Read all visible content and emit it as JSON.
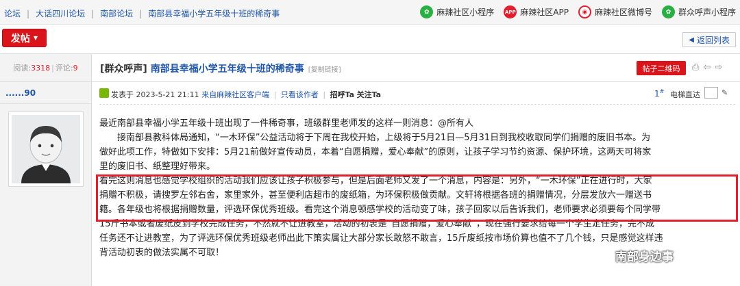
{
  "breadcrumb": [
    "论坛",
    "大话四川论坛",
    "南部论坛",
    "南部县幸福小学五年级十班的稀奇事"
  ],
  "top_links": [
    {
      "label": "麻辣社区小程序",
      "icon": "mini-program-icon"
    },
    {
      "label": "麻辣社区APP",
      "icon": "app-icon",
      "icon_text": "APP"
    },
    {
      "label": "麻辣社区微博号",
      "icon": "weibo-icon"
    },
    {
      "label": "群众呼声小程序",
      "icon": "mini-program-icon"
    }
  ],
  "toolbar": {
    "post_label": "发帖",
    "back_label": "返回列表"
  },
  "thread": {
    "stats_read_label": "阅读:",
    "stats_read": "3318",
    "stats_sep": "|",
    "stats_reply_label": "评论:",
    "stats_reply": "9",
    "category": "[群众呼声]",
    "title": "南部县幸福小学五年级十班的稀奇事",
    "copy_link": "[复制链接]",
    "qr_label": "帖子二维码"
  },
  "user": {
    "name": "......90"
  },
  "post": {
    "posted_prefix": "发表于",
    "posted_time": "2023-5-21 21:11",
    "source": "来自麻辣社区客户端",
    "author_only": "只看该作者",
    "recruit": "招呼Ta",
    "follow": "关注Ta",
    "floor": "1",
    "floor_sup": "#",
    "elevator_label": "电梯直达"
  },
  "content": {
    "lines": [
      "最近南部县幸福小学五年级十班出现了一件稀奇事，班级群里老师发的这样一则消息：@所有人",
      "接南部县教科体局通知，“一木环保”公益活动将于下周在我校开始，上级将于5月21日—5月31日到我校收取同学们捐赠的废旧书本。为",
      "做好此项工作，特做如下安排：5月21前做好宣传动员，本着“自愿捐赠，爱心奉献”的原则，让孩子学习节约资源、保护环境，这两天可将家",
      "里的废旧书、纸整理好带来。",
      "看完这则消息也感觉学校组织的活动我们应该让孩子积极参与，但是后面老师又发了一个消息，内容是：另外，“一木环保”正在进行时，大家",
      "捐赠不积极，请搜罗左邻右舍，家里家外，甚至便利店超市的废纸箱，为环保积极做贡献。文轩将根据各班的捐赠情况，分层发放六一赠送书",
      "籍。各年级也将根据捐赠数量，评选环保优秀班级。看完这个消息顿感学校的活动变了味，孩子回家以后告诉我们，老师要求必须要每个同学带",
      "15斤书本或者废纸皮到学校完成任务，不然就不让进教室，活动的初衷是“自愿捐赠，爱心奉献”，现在强行要求给每一个学生定任务，完不成",
      "任务还不让进教室，为了评选环保优秀班级老师出此下策实属让大部分家长敢怒不敢言，15斤废纸按市场价算也值不了几个钱，只是感觉这样违",
      "背活动初衷的做法实属不可取！"
    ]
  },
  "watermark": "南部身边事"
}
